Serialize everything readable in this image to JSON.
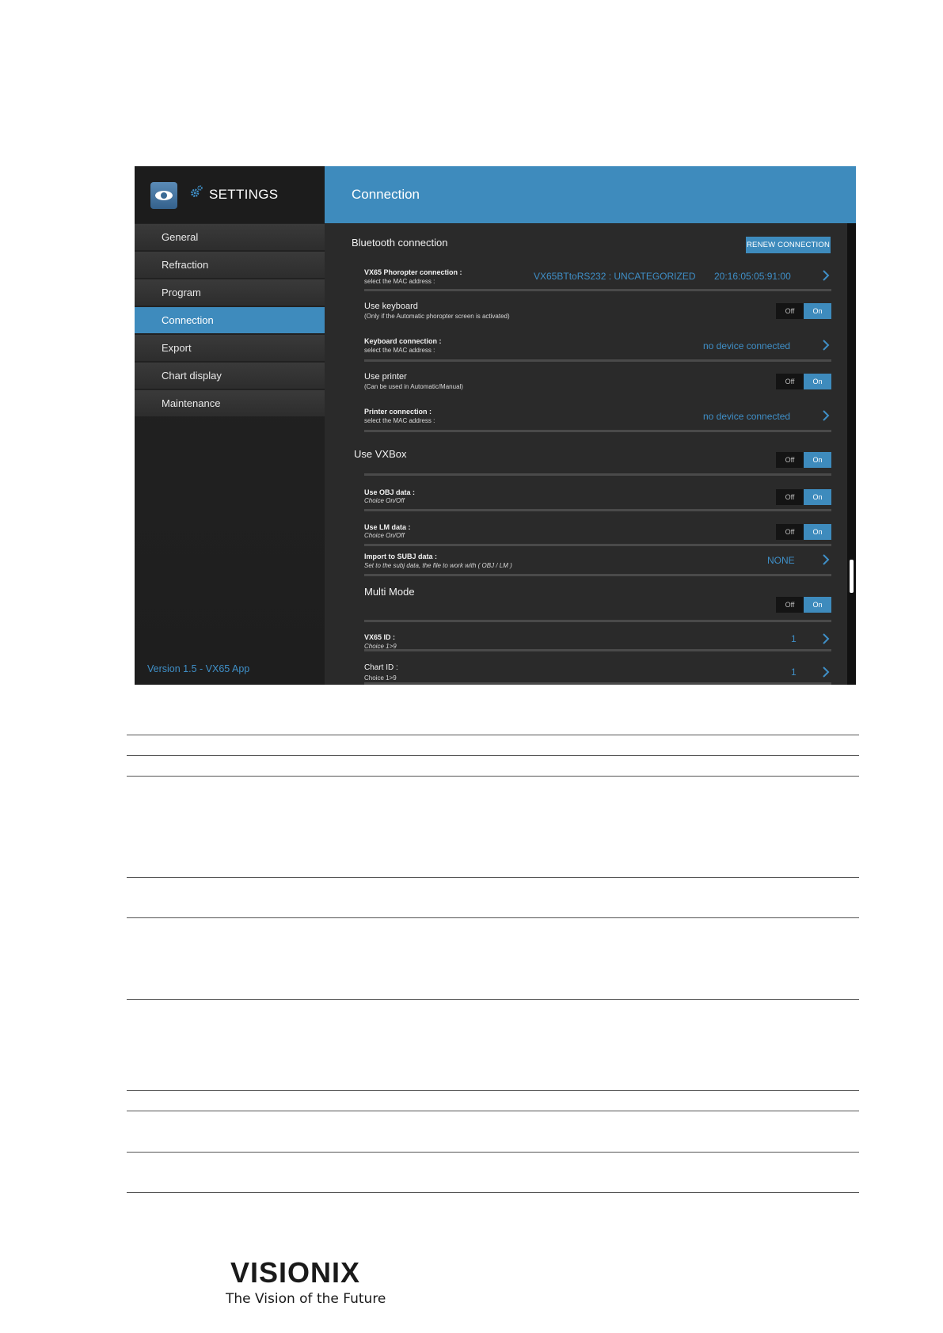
{
  "sidebar": {
    "title": "SETTINGS",
    "items": [
      {
        "label": "General"
      },
      {
        "label": "Refraction"
      },
      {
        "label": "Program"
      },
      {
        "label": "Connection"
      },
      {
        "label": "Export"
      },
      {
        "label": "Chart display"
      },
      {
        "label": "Maintenance"
      }
    ],
    "active_index": 3,
    "version": "Version 1.5 - VX65 App"
  },
  "header": {
    "title": "Connection"
  },
  "content": {
    "bluetooth": {
      "title": "Bluetooth connection",
      "renew_label": "RENEW CONNECTION",
      "phoropter": {
        "label": "VX65 Phoropter connection :",
        "sub": "select the MAC address :",
        "device": "VX65BTtoRS232 : UNCATEGORIZED",
        "mac": "20:16:05:05:91:00"
      },
      "use_keyboard": {
        "label": "Use keyboard",
        "sub": "(Only if the Automatic phoropter screen is activated)"
      },
      "keyboard_connection": {
        "label": "Keyboard connection :",
        "sub": "select the MAC address :",
        "value": "no device connected"
      },
      "use_printer": {
        "label": "Use printer",
        "sub": "(Can be used in Automatic/Manual)"
      },
      "printer_connection": {
        "label": "Printer connection :",
        "sub": "select the MAC address :",
        "value": "no device connected"
      }
    },
    "vxbox": {
      "title": "Use VXBox",
      "obj": {
        "label": "Use OBJ data :",
        "sub": "Choice On/Off"
      },
      "lm": {
        "label": "Use LM data :",
        "sub": "Choice On/Off"
      },
      "import": {
        "label": "Import to SUBJ data :",
        "sub": "Set to the subj data, the file to work with ( OBJ / LM )",
        "value": "NONE"
      }
    },
    "multi_mode": {
      "title": "Multi Mode",
      "vx65_id": {
        "label": "VX65 ID :",
        "sub": "Choice 1>9",
        "value": "1"
      },
      "chart_id": {
        "label": "Chart ID :",
        "sub": "Choice 1>9",
        "value": "1"
      }
    }
  },
  "toggle": {
    "off": "Off",
    "on": "On"
  },
  "footer": {
    "brand": "VISIONIX",
    "tagline": "The Vision of the Future"
  }
}
